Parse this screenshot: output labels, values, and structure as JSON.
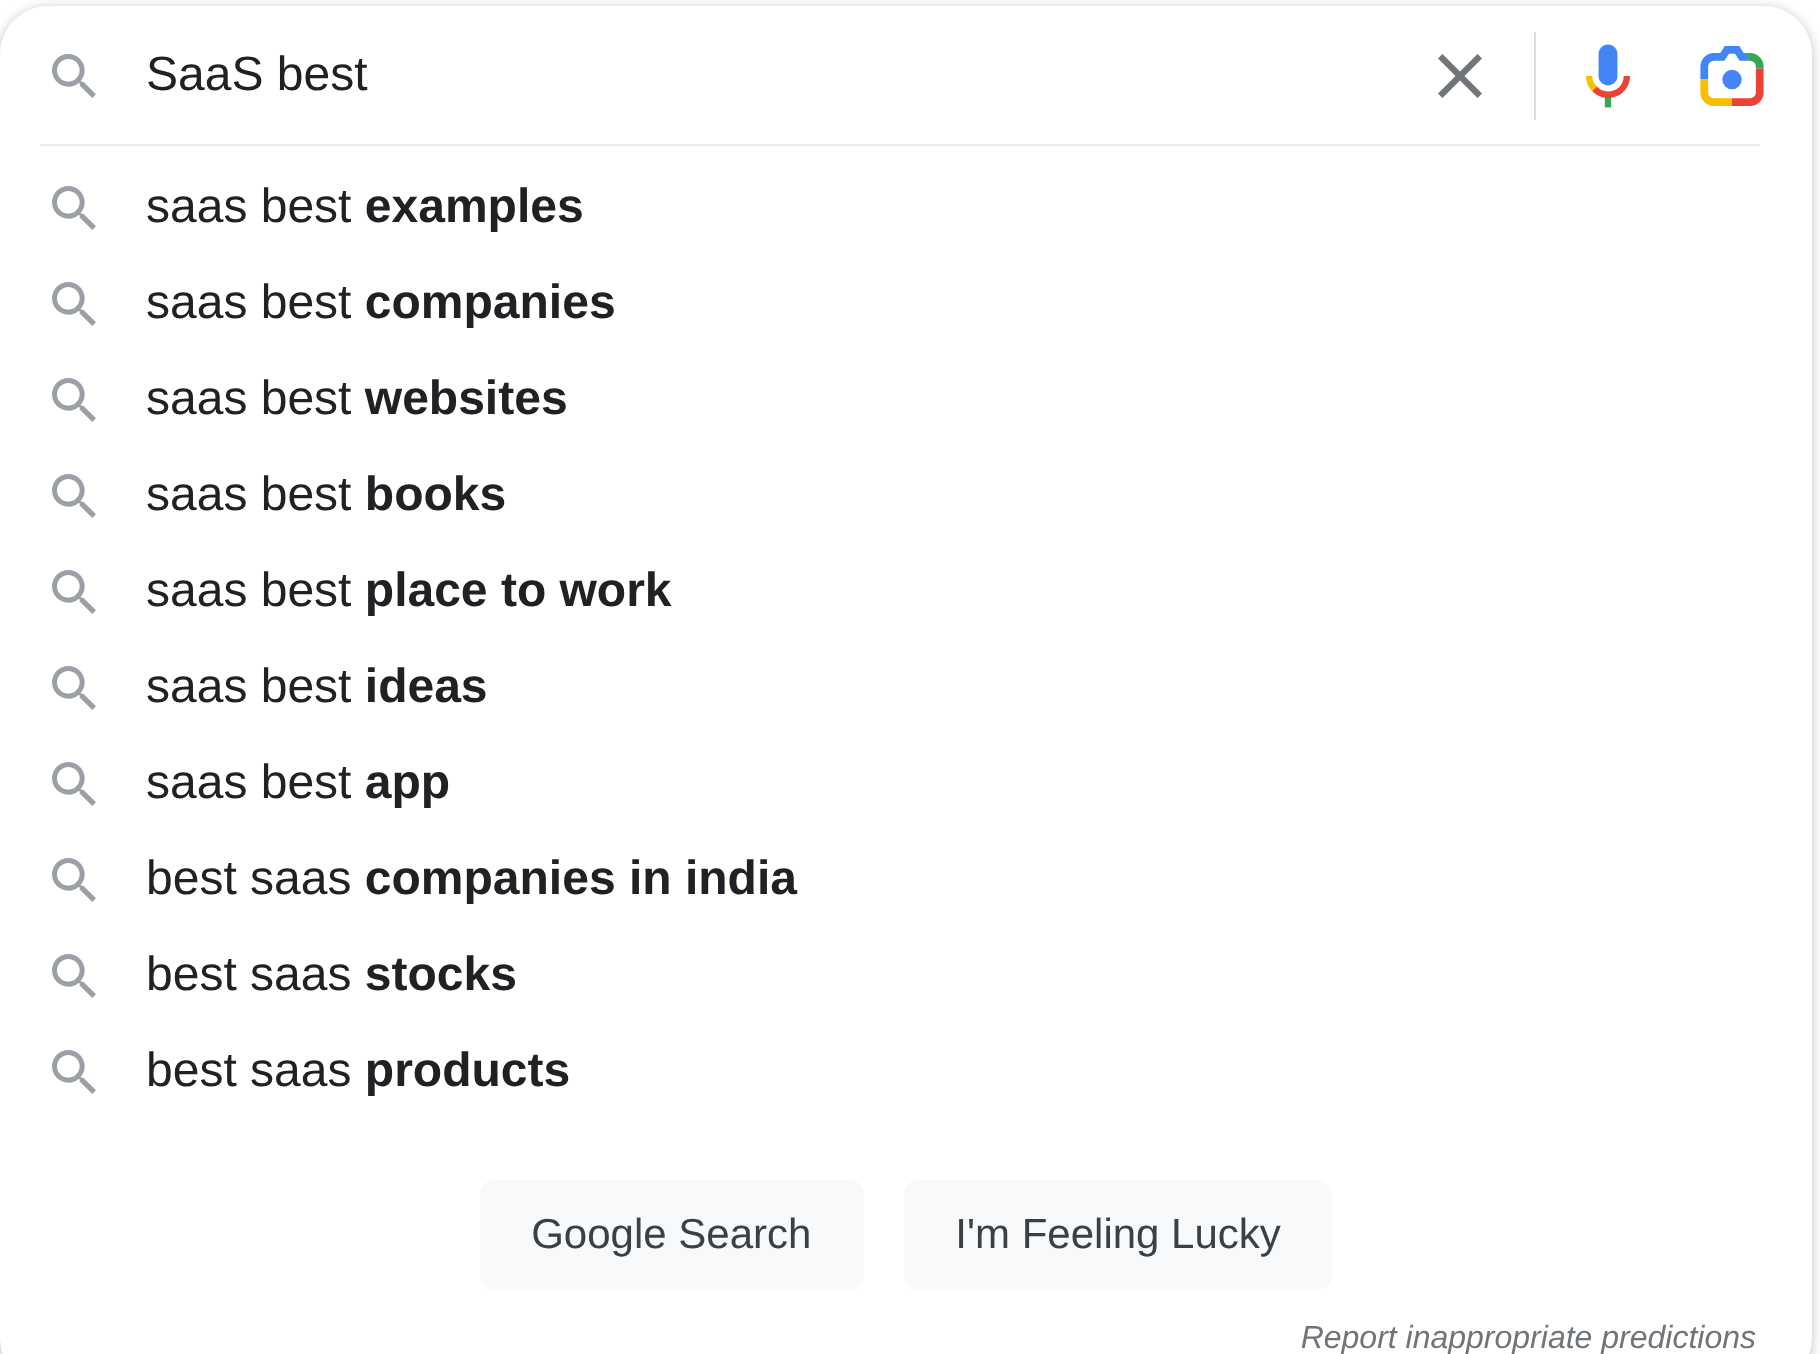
{
  "search_bar": {
    "value": "SaaS best"
  },
  "suggestions": [
    {
      "text": "saas best **examples**"
    },
    {
      "text": "saas best **companies**"
    },
    {
      "text": "saas best **websites**"
    },
    {
      "text": "saas best **books**"
    },
    {
      "text": "saas best **place to work**"
    },
    {
      "text": "saas best **ideas**"
    },
    {
      "text": "saas best **app**"
    },
    {
      "text": "best saas **companies in india**"
    },
    {
      "text": "best saas **stocks**"
    },
    {
      "text": "best saas **products**"
    }
  ],
  "buttons": [
    {
      "label": "Google Search"
    },
    {
      "label": "I'm Feeling Lucky"
    }
  ],
  "footer_link": {
    "label": "Report inappropriate predictions"
  }
}
